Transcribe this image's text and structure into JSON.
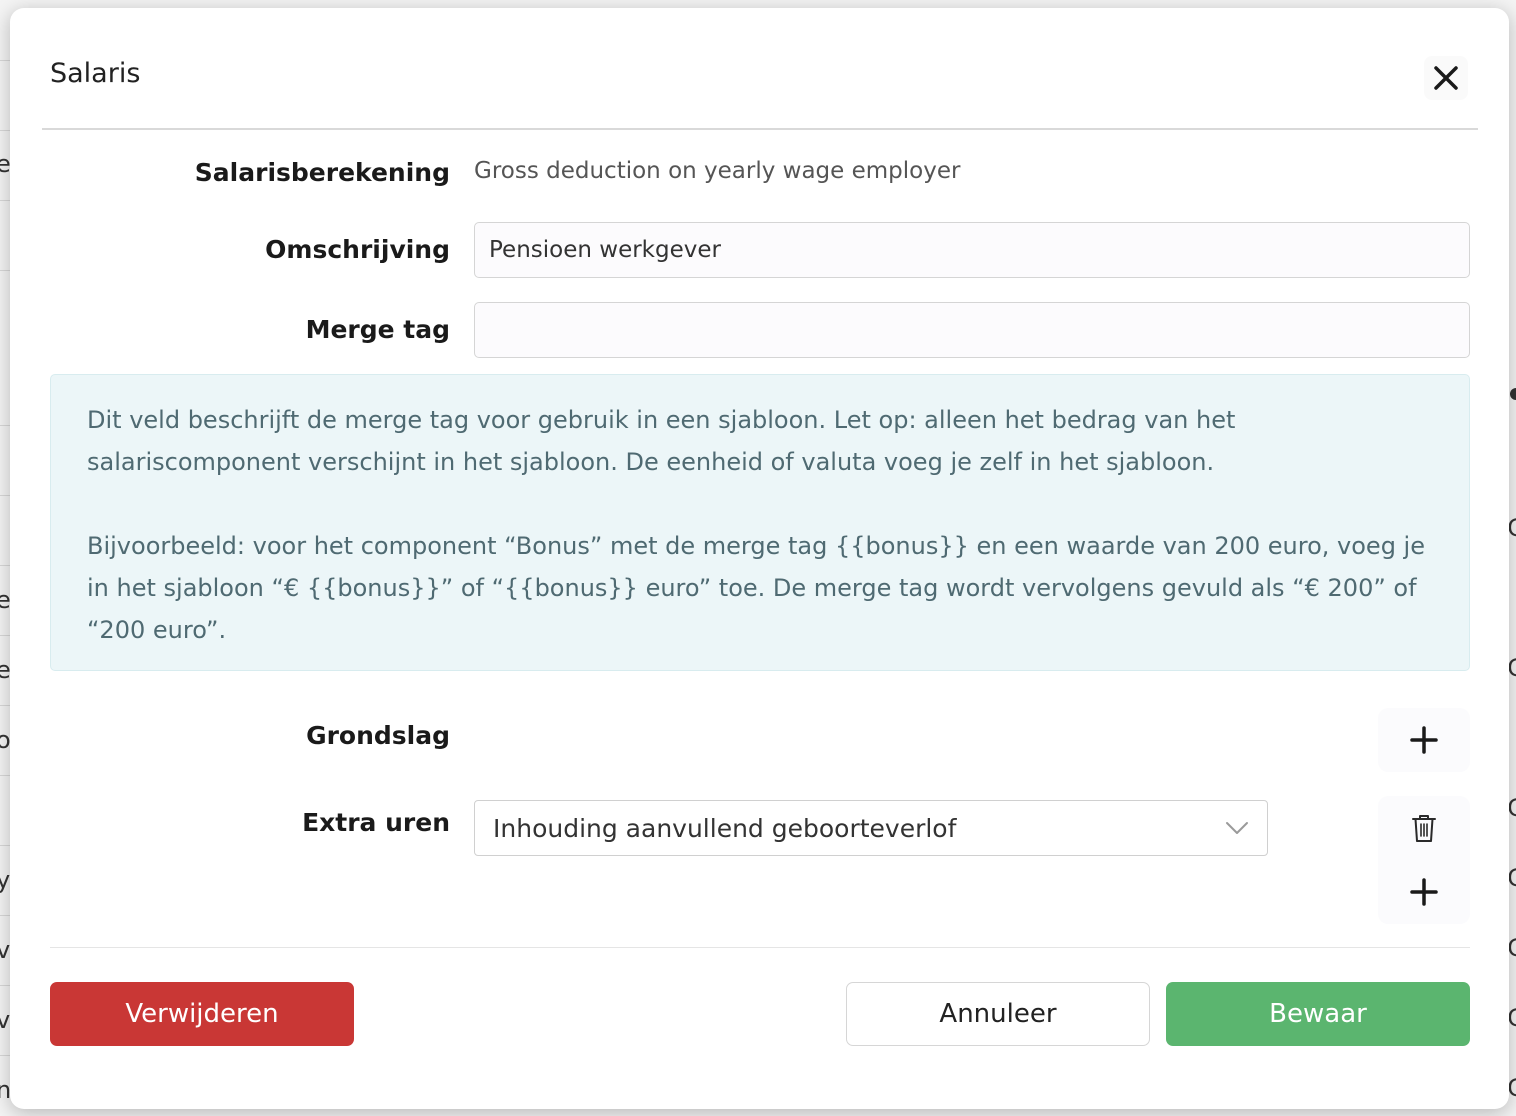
{
  "background": {
    "left_glyphs": [
      "e",
      "e",
      "e",
      "o",
      "y",
      "v",
      "v",
      "n"
    ],
    "right_glyphs": [
      "C",
      "C",
      "C",
      "C",
      "C",
      "C",
      "C"
    ]
  },
  "modal": {
    "title": "Salaris",
    "close_icon": "close-icon"
  },
  "form": {
    "salary_calc": {
      "label": "Salarisberekening",
      "value": "Gross deduction on yearly wage employer"
    },
    "description": {
      "label": "Omschrijving",
      "value": "Pensioen werkgever",
      "placeholder": ""
    },
    "merge_tag": {
      "label": "Merge tag",
      "value": "",
      "placeholder": ""
    },
    "info": {
      "paragraph_1": "Dit veld beschrijft de merge tag voor gebruik in een sjabloon. Let op: alleen het bedrag van het salariscomponent verschijnt in het sjabloon. De eenheid of valuta voeg je zelf in het sjabloon.",
      "paragraph_2": "Bijvoorbeeld: voor het component “Bonus” met de merge tag {{bonus}} en een waarde van 200 euro, voeg je in het sjabloon “€ {{bonus}}” of “{{bonus}} euro” toe. De merge tag wordt vervolgens gevuld als “€ 200” of “200 euro”."
    },
    "grondslag": {
      "label": "Grondslag",
      "add_icon": "plus-icon"
    },
    "extra_uren": {
      "label": "Extra uren",
      "selected": "Inhouding aanvullend geboorteverlof",
      "dropdown_icon": "chevron-down-icon",
      "delete_icon": "trash-icon",
      "add_icon": "plus-icon"
    }
  },
  "footer": {
    "delete_label": "Verwijderen",
    "cancel_label": "Annuleer",
    "save_label": "Bewaar"
  },
  "colors": {
    "danger": "#c93735",
    "success": "#5bb56f",
    "info_bg": "#ecf6f8",
    "info_text": "#4f6a72"
  }
}
